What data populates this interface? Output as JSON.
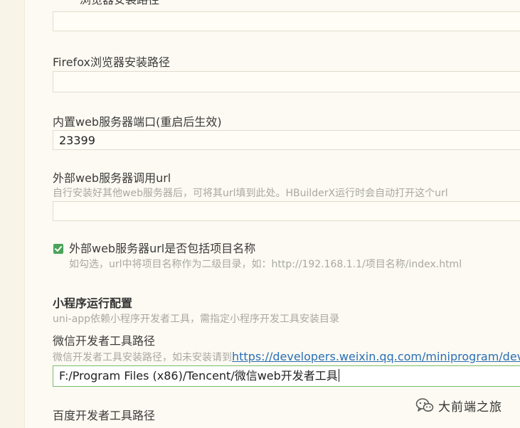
{
  "settings": {
    "fields": {
      "cut_top_label": "浏览器安装路径",
      "firefox_label": "Firefox浏览器安装路径",
      "firefox_path": "",
      "web_port_label": "内置web服务器端口(重启后生效)",
      "web_port_value": "23399",
      "external_web_label": "外部web服务器调用url",
      "external_web_hint": "自行安装好其他web服务器后，可将其url填到此处。HBuilderX运行时会自动打开这个url",
      "external_web_value": "",
      "include_project_label": "外部web服务器url是否包括项目名称",
      "include_project_hint": "如勾选，url中将项目名称作为二级目录，如：http://192.168.1.1/项目名称/index.html",
      "include_project_checked": true
    },
    "miniprogram": {
      "section_title": "小程序运行配置",
      "section_hint": "uni-app依赖小程序开发者工具，需指定小程序开发工具安装目录",
      "wechat_label": "微信开发者工具路径",
      "wechat_hint_prefix": "微信开发者工具安装路径，如未安装请到",
      "wechat_hint_link": "https://developers.weixin.qq.com/miniprogram/dev/",
      "wechat_path": "F:/Program Files (x86)/Tencent/微信web开发者工具",
      "baidu_label": "百度开发者工具路径"
    }
  },
  "watermark": {
    "text": "大前端之旅",
    "icon": "wechat-icon"
  },
  "colors": {
    "background": "#fcfaf2",
    "checkbox": "#4aa35a",
    "link": "#2a6fb8",
    "active_border": "#7bbd6a"
  }
}
